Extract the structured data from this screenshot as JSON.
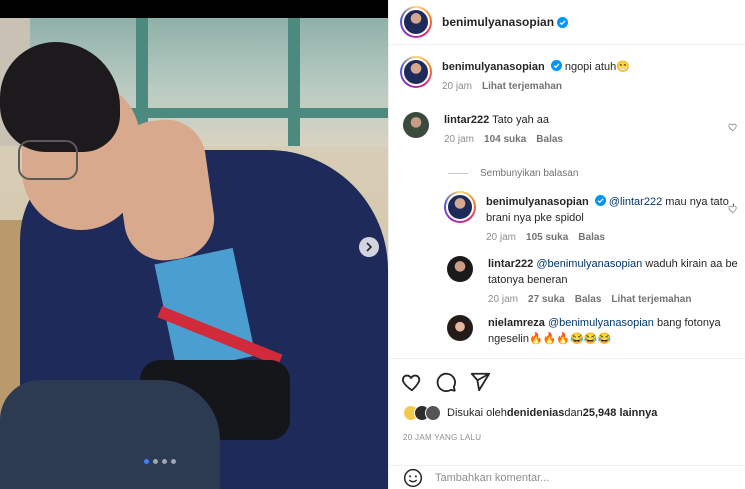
{
  "post": {
    "author": "benimulyanasopian",
    "verified": true,
    "carousel": {
      "current": 1,
      "count": 4
    }
  },
  "caption": {
    "author": "benimulyanasopian",
    "text": "ngopi atuh😁",
    "time": "20 jam",
    "translate": "Lihat terjemahan"
  },
  "comments": [
    {
      "author": "lintar222",
      "text": "Tato yah aa",
      "time": "20 jam",
      "likes": "104 suka",
      "reply": "Balas"
    }
  ],
  "hide_replies": "Sembunyikan balasan",
  "replies": [
    {
      "author": "benimulyanasopian",
      "mention": "@lintar222",
      "text_line1": " mau nya tato ,",
      "text_line2": "brani nya pke spidol",
      "time": "20 jam",
      "likes": "105 suka",
      "reply": "Balas"
    },
    {
      "author": "lintar222",
      "mention": "@benimulyanasopian",
      "text_line1": " waduh kirain aa be",
      "text_line2": "tatonya beneran",
      "time": "20 jam",
      "likes": "27 suka",
      "reply": "Balas",
      "translate": "Lihat terjemahan"
    },
    {
      "author": "nielamreza",
      "mention": "@benimulyanasopian",
      "text_line1": " bang fotonya",
      "text_line2": "ngeselin🔥🔥🔥😂😂😂"
    }
  ],
  "likes_summary": {
    "prefix": "Disukai oleh ",
    "user": "denidenias",
    "middle": " dan ",
    "count": "25,948 lainnya"
  },
  "time_ago": "20 JAM YANG LALU",
  "add_comment": {
    "placeholder": "Tambahkan komentar..."
  },
  "colors": {
    "verified": "#0095f6",
    "mention": "#00376b",
    "dot_active": "#3b82f6"
  },
  "icons": [
    "check-verified-icon",
    "heart-icon",
    "comment-icon",
    "share-icon",
    "emoji-icon",
    "chevron-right-icon"
  ]
}
